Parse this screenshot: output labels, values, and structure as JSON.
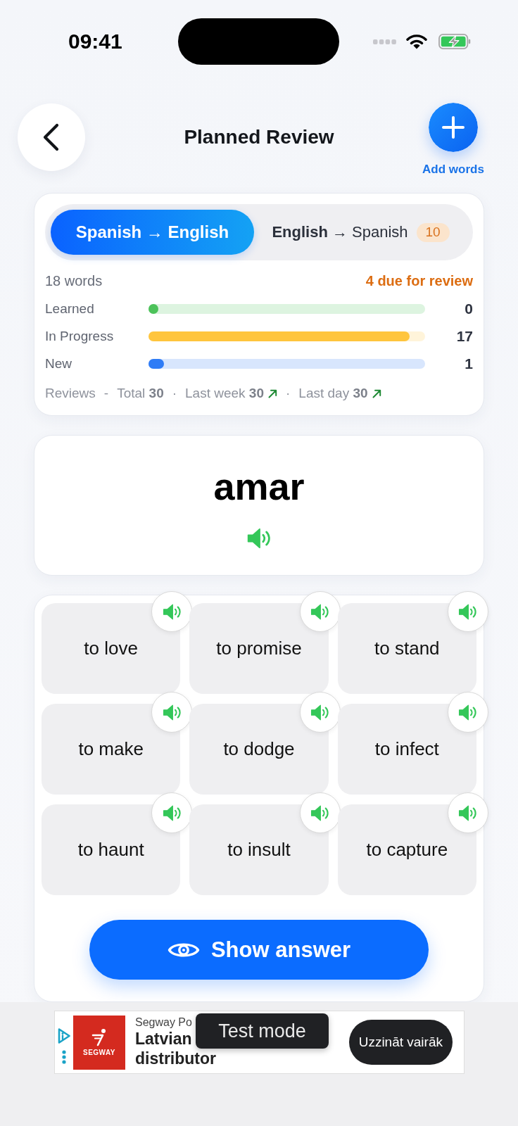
{
  "status_bar": {
    "time": "09:41"
  },
  "header": {
    "title": "Planned Review",
    "add_label": "Add words"
  },
  "stats": {
    "directions": [
      {
        "label": "Spanish → English",
        "selected": true
      },
      {
        "label": "**English** → Spanish",
        "selected": false,
        "badge": "10"
      }
    ],
    "word_count": "18 words",
    "due": "4 due for review",
    "rows": [
      {
        "label": "Learned",
        "level": 0,
        "count": "0",
        "color": "#4cc25a"
      },
      {
        "label": "In Progress",
        "level": 0.944,
        "count": "17",
        "color": "#ffc53d"
      },
      {
        "label": "New",
        "level": 0.056,
        "count": "1",
        "color": "#2f7cf6"
      }
    ],
    "reviews": {
      "label": "Reviews",
      "items": [
        {
          "separator": "-",
          "text": "Total **30**",
          "trend_up": false
        },
        {
          "separator": "·",
          "text": "Last week **30**",
          "trend_up": true
        },
        {
          "separator": "·",
          "text": "Last day **30**",
          "trend_up": true
        }
      ]
    }
  },
  "word": {
    "text": "amar"
  },
  "options": [
    {
      "text": "to love"
    },
    {
      "text": "to promise"
    },
    {
      "text": "to stand"
    },
    {
      "text": "to make"
    },
    {
      "text": "to dodge"
    },
    {
      "text": "to infect"
    },
    {
      "text": "to haunt"
    },
    {
      "text": "to insult"
    },
    {
      "text": "to capture"
    }
  ],
  "show_answer": {
    "label": "Show answer"
  },
  "ad": {
    "logo_text": "SEGWAY",
    "sponsor": "Segway Po",
    "headline": [
      "Latvian",
      "distributor"
    ],
    "cta": "Uzzināt vairāk"
  },
  "toast": {
    "text": "Test mode"
  }
}
